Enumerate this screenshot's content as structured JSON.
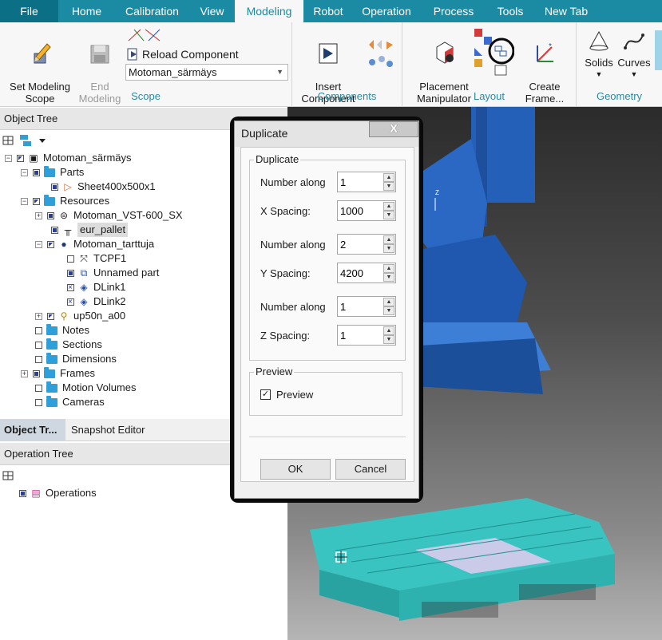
{
  "tabs": [
    "File",
    "Home",
    "Calibration",
    "View",
    "Modeling",
    "Robot",
    "Operation",
    "Process",
    "Tools",
    "New Tab"
  ],
  "active_tab": "Modeling",
  "ribbon": {
    "scope": {
      "set_modeling_scope": "Set Modeling\nScope",
      "end_modeling": "End\nModeling",
      "reload_component": "Reload Component",
      "combo_value": "Motoman_särmäys",
      "label": "Scope"
    },
    "components": {
      "insert_component": "Insert\nComponent",
      "label": "Components"
    },
    "layout": {
      "placement_manipulator": "Placement\nManipulator",
      "create_frame": "Create\nFrame...",
      "label": "Layout"
    },
    "geometry": {
      "solids": "Solids",
      "curves": "Curves",
      "label": "Geometry"
    }
  },
  "object_tree": {
    "title": "Object Tree",
    "items": [
      {
        "label": "Motoman_särmäys"
      },
      {
        "label": "Parts"
      },
      {
        "label": "Sheet400x500x1"
      },
      {
        "label": "Resources"
      },
      {
        "label": "Motoman_VST-600_SX"
      },
      {
        "label": "eur_pallet"
      },
      {
        "label": "Motoman_tarttuja"
      },
      {
        "label": "TCPF1"
      },
      {
        "label": "Unnamed part"
      },
      {
        "label": "DLink1"
      },
      {
        "label": "DLink2"
      },
      {
        "label": "up50n_a00"
      },
      {
        "label": "Notes"
      },
      {
        "label": "Sections"
      },
      {
        "label": "Dimensions"
      },
      {
        "label": "Frames"
      },
      {
        "label": "Motion Volumes"
      },
      {
        "label": "Cameras"
      }
    ]
  },
  "bottom_tabs": {
    "object_tree": "Object Tr...",
    "snapshot_editor": "Snapshot Editor"
  },
  "operation_tree": {
    "title": "Operation Tree",
    "items": [
      {
        "label": "Operations"
      }
    ]
  },
  "dialog": {
    "title": "Duplicate",
    "close": "X",
    "group_duplicate": "Duplicate",
    "fields": [
      {
        "label": "Number along",
        "value": "1"
      },
      {
        "label": "X Spacing:",
        "value": "1000"
      },
      {
        "label": "Number along",
        "value": "2"
      },
      {
        "label": "Y Spacing:",
        "value": "4200"
      },
      {
        "label": "Number along",
        "value": "1"
      },
      {
        "label": "Z Spacing:",
        "value": "1"
      }
    ],
    "group_preview": "Preview",
    "preview_checkbox": "Preview",
    "preview_checked": true,
    "ok": "OK",
    "cancel": "Cancel"
  },
  "viewport": {
    "axis_label": "Z"
  }
}
